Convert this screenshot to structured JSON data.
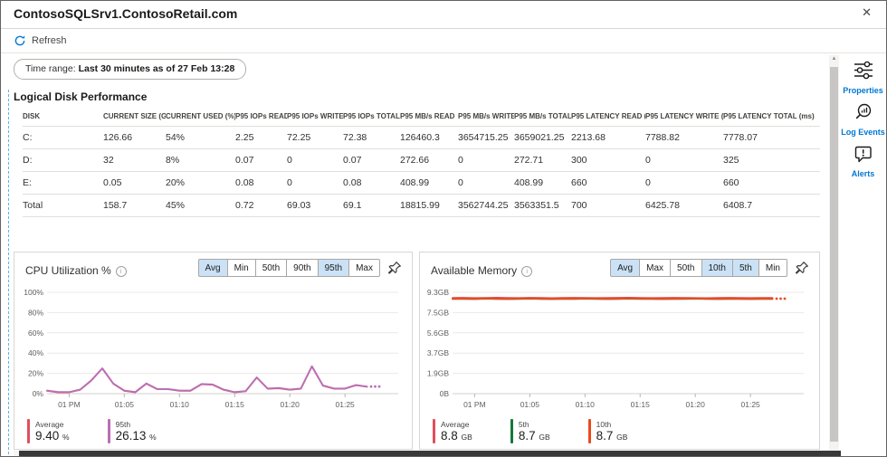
{
  "window": {
    "title": "ContosoSQLSrv1.ContosoRetail.com",
    "close_glyph": "✕"
  },
  "toolbar": {
    "refresh_label": "Refresh"
  },
  "time_range": {
    "prefix": "Time range: ",
    "value": "Last 30 minutes as of 27 Feb 13:28"
  },
  "disk_table": {
    "title": "Logical Disk Performance",
    "columns": [
      "DISK",
      "CURRENT SIZE (GB)",
      "CURRENT USED (%)",
      "P95 IOPs READ",
      "P95 IOPs WRITE",
      "P95 IOPs TOTAL",
      "P95 MB/s READ",
      "P95 MB/s WRITE",
      "P95 MB/s TOTAL",
      "P95 LATENCY READ (ms)",
      "P95 LATENCY WRITE (ms)",
      "P95 LATENCY TOTAL (ms)"
    ],
    "rows": [
      [
        "C:",
        "126.66",
        "54%",
        "2.25",
        "72.25",
        "72.38",
        "126460.3",
        "3654715.25",
        "3659021.25",
        "2213.68",
        "7788.82",
        "7778.07"
      ],
      [
        "D:",
        "32",
        "8%",
        "0.07",
        "0",
        "0.07",
        "272.66",
        "0",
        "272.71",
        "300",
        "0",
        "325"
      ],
      [
        "E:",
        "0.05",
        "20%",
        "0.08",
        "0",
        "0.08",
        "408.99",
        "0",
        "408.99",
        "660",
        "0",
        "660"
      ],
      [
        "Total",
        "158.7",
        "45%",
        "0.72",
        "69.03",
        "69.1",
        "18815.99",
        "3562744.25",
        "3563351.5",
        "700",
        "6425.78",
        "6408.7"
      ]
    ]
  },
  "icons": {
    "info_glyph": "i",
    "scroll_up_glyph": "▲"
  },
  "sidebar": {
    "items": [
      {
        "label": "Properties"
      },
      {
        "label": "Log Events"
      },
      {
        "label": "Alerts"
      }
    ]
  },
  "chart_data": [
    {
      "type": "line",
      "title": "CPU Utilization %",
      "toggles": [
        {
          "label": "Avg",
          "selected": true
        },
        {
          "label": "Min",
          "selected": false
        },
        {
          "label": "50th",
          "selected": false
        },
        {
          "label": "90th",
          "selected": false
        },
        {
          "label": "95th",
          "selected": true
        },
        {
          "label": "Max",
          "selected": false
        }
      ],
      "ylim": [
        0,
        100
      ],
      "yticks": [
        "100%",
        "80%",
        "60%",
        "40%",
        "20%",
        "0%"
      ],
      "xticks": [
        "01 PM",
        "01:05",
        "01:10",
        "01:15",
        "01:20",
        "01:25"
      ],
      "x_first_tick_min": 2,
      "x_tick_step_min": 5,
      "x_span_min": 31.5,
      "time_window": "12:58 - 13:28",
      "grid": true,
      "legend_position": "bottom",
      "trailing_dots": 3,
      "series": [
        {
          "name": "Average",
          "color": "#e04f5f",
          "stroke_width": 1.5,
          "legend_value": "9.40",
          "legend_unit": "%",
          "values": [
            2.7,
            1.2,
            1.2,
            3.7,
            12.7,
            24.7,
            9.7,
            2.7,
            1.2,
            9.7,
            4.2,
            4.2,
            2.7,
            2.7,
            9.2,
            8.7,
            3.7,
            1.2,
            2.2,
            15.7,
            4.7,
            5.2,
            3.7,
            4.7,
            26.7,
            7.7,
            4.7,
            4.7,
            8.2,
            6.7
          ]
        },
        {
          "name": "95th",
          "color": "#bb6fb2",
          "stroke_width": 2,
          "legend_value": "26.13",
          "legend_unit": "%",
          "values": [
            3,
            1.5,
            1.5,
            4,
            13,
            25,
            10,
            3,
            1.5,
            10,
            4.5,
            4.5,
            3,
            3,
            9.5,
            9,
            4,
            1.5,
            2.5,
            16,
            5,
            5.5,
            4,
            5,
            27,
            8,
            5,
            5,
            8.5,
            7
          ]
        }
      ]
    },
    {
      "type": "line",
      "title": "Available Memory",
      "toggles": [
        {
          "label": "Avg",
          "selected": true
        },
        {
          "label": "Max",
          "selected": false
        },
        {
          "label": "50th",
          "selected": false
        },
        {
          "label": "10th",
          "selected": true
        },
        {
          "label": "5th",
          "selected": true
        },
        {
          "label": "Min",
          "selected": false
        }
      ],
      "ylim": [
        0,
        9.3
      ],
      "yticks": [
        "9.3GB",
        "7.5GB",
        "5.6GB",
        "3.7GB",
        "1.9GB",
        "0B"
      ],
      "xticks": [
        "01 PM",
        "01:05",
        "01:10",
        "01:15",
        "01:20",
        "01:25"
      ],
      "x_first_tick_min": 2,
      "x_tick_step_min": 5,
      "x_span_min": 31.5,
      "time_window": "12:58 - 13:28",
      "grid": true,
      "legend_position": "bottom",
      "trailing_dots": 3,
      "series": [
        {
          "name": "Average",
          "color": "#e04f5f",
          "stroke_width": 1.5,
          "legend_value": "8.8",
          "legend_unit": "GB",
          "values": [
            8.8,
            8.81,
            8.79,
            8.8,
            8.82,
            8.8,
            8.79,
            8.81,
            8.8,
            8.78,
            8.8,
            8.81,
            8.8,
            8.79,
            8.8,
            8.81,
            8.82,
            8.8,
            8.79,
            8.8,
            8.81,
            8.8,
            8.79,
            8.78,
            8.8,
            8.81,
            8.8,
            8.79,
            8.8,
            8.8
          ]
        },
        {
          "name": "5th",
          "color": "#15783c",
          "stroke_width": 1.5,
          "legend_value": "8.7",
          "legend_unit": "GB",
          "values": [
            8.68,
            8.68,
            8.67,
            8.69,
            8.68,
            8.67,
            8.68,
            8.69,
            8.68,
            8.67,
            8.68,
            8.68,
            8.69,
            8.68,
            8.67,
            8.68,
            8.69,
            8.68,
            8.68,
            8.67,
            8.68,
            8.68,
            8.69,
            8.68,
            8.67,
            8.68,
            8.68,
            8.67,
            8.68,
            8.68
          ]
        },
        {
          "name": "10th",
          "color": "#ea4a1f",
          "stroke_width": 2.2,
          "legend_value": "8.7",
          "legend_unit": "GB",
          "values": [
            8.72,
            8.73,
            8.71,
            8.74,
            8.72,
            8.7,
            8.73,
            8.74,
            8.72,
            8.71,
            8.73,
            8.72,
            8.74,
            8.73,
            8.71,
            8.72,
            8.74,
            8.73,
            8.72,
            8.7,
            8.72,
            8.73,
            8.74,
            8.72,
            8.71,
            8.73,
            8.72,
            8.71,
            8.73,
            8.72
          ]
        }
      ]
    }
  ]
}
